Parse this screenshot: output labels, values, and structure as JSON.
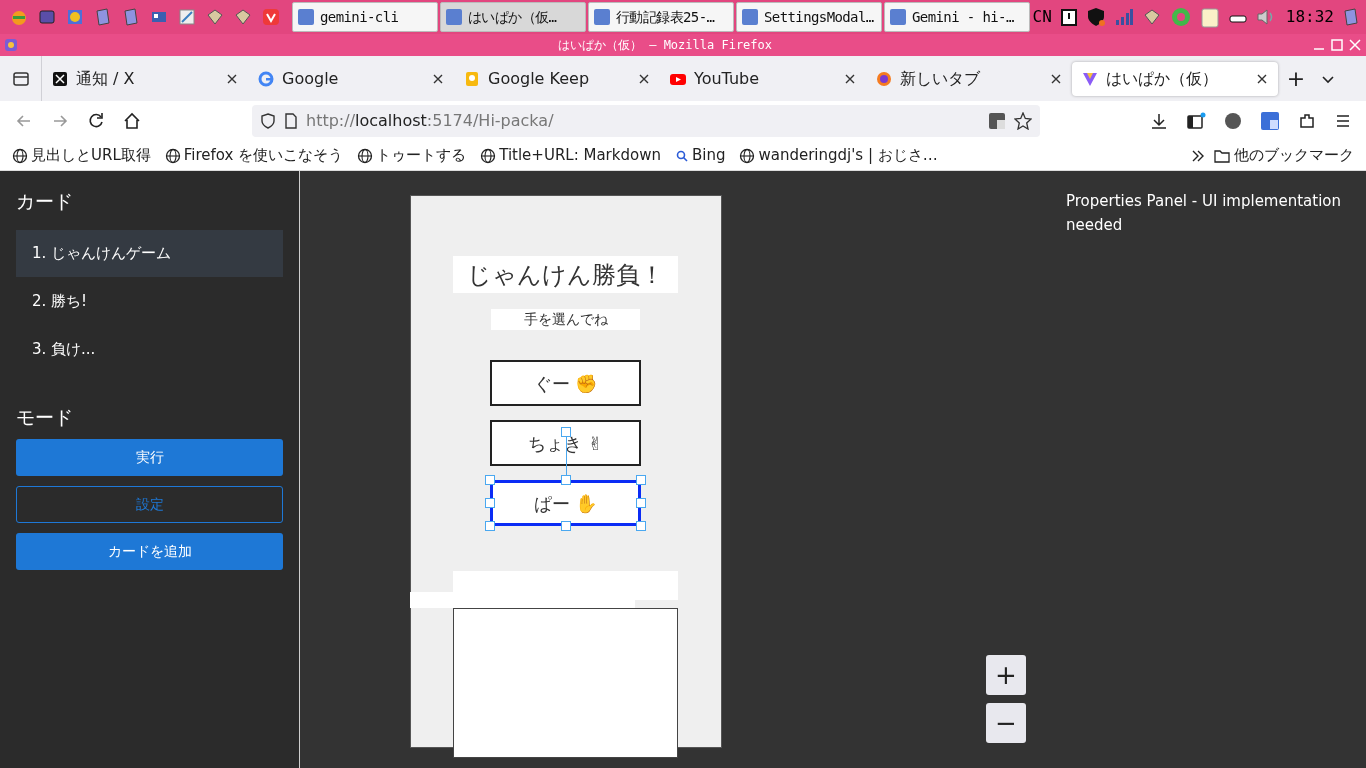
{
  "taskbar": {
    "tasks": [
      {
        "label": "gemini-cli",
        "selected": false
      },
      {
        "label": "はいぱか（仮…",
        "selected": true
      },
      {
        "label": "行動記録表25-…",
        "selected": false
      },
      {
        "label": "SettingsModal…",
        "selected": false
      },
      {
        "label": "Gemini - hi-…",
        "selected": false
      }
    ],
    "keyboard": "CN",
    "clock": "18:32"
  },
  "window": {
    "title": "はいぱか（仮） — Mozilla Firefox"
  },
  "browser": {
    "tabs": [
      {
        "label": "通知 / X",
        "selected": false
      },
      {
        "label": "Google",
        "selected": false
      },
      {
        "label": "Google Keep",
        "selected": false
      },
      {
        "label": "YouTube",
        "selected": false
      },
      {
        "label": "新しいタブ",
        "selected": false
      },
      {
        "label": "はいぱか（仮）",
        "selected": true
      }
    ],
    "new_tab": "+",
    "url": {
      "scheme": "http://",
      "host": "localhost",
      "path": ":5174/Hi-packa/"
    },
    "bookmarks": [
      {
        "label": "見出しとURL取得"
      },
      {
        "label": "Firefox を使いこなそう"
      },
      {
        "label": "トゥートする"
      },
      {
        "label": "Title+URL: Markdown"
      },
      {
        "label": "Bing"
      },
      {
        "label": "wanderingdj's | おじさ…"
      }
    ],
    "other_bookmarks": "他のブックマーク"
  },
  "sidebar": {
    "cards_heading": "カード",
    "cards": [
      {
        "label": "1. じゃんけんゲーム",
        "selected": true
      },
      {
        "label": "2. 勝ち!",
        "selected": false
      },
      {
        "label": "3. 負け...",
        "selected": false
      }
    ],
    "mode_heading": "モード",
    "buttons": [
      {
        "label": "実行",
        "kind": "primary"
      },
      {
        "label": "設定",
        "kind": "outline"
      },
      {
        "label": "カードを追加",
        "kind": "primary"
      }
    ]
  },
  "canvas": {
    "elements": [
      {
        "kind": "heading",
        "text": "じゃんけん勝負！",
        "selected": false
      },
      {
        "kind": "text",
        "text": "手を選んでね",
        "selected": false
      },
      {
        "kind": "button",
        "text": "ぐー ✊",
        "selected": false
      },
      {
        "kind": "button",
        "text": "ちょき ✌",
        "selected": false
      },
      {
        "kind": "button",
        "text": "ぱー ✋",
        "selected": true
      },
      {
        "kind": "blank",
        "selected": false
      },
      {
        "kind": "blank",
        "selected": false
      },
      {
        "kind": "frame",
        "selected": false
      }
    ],
    "zoom_in": "+",
    "zoom_out": "−"
  },
  "properties": {
    "message": "Properties Panel - UI implementation needed"
  }
}
